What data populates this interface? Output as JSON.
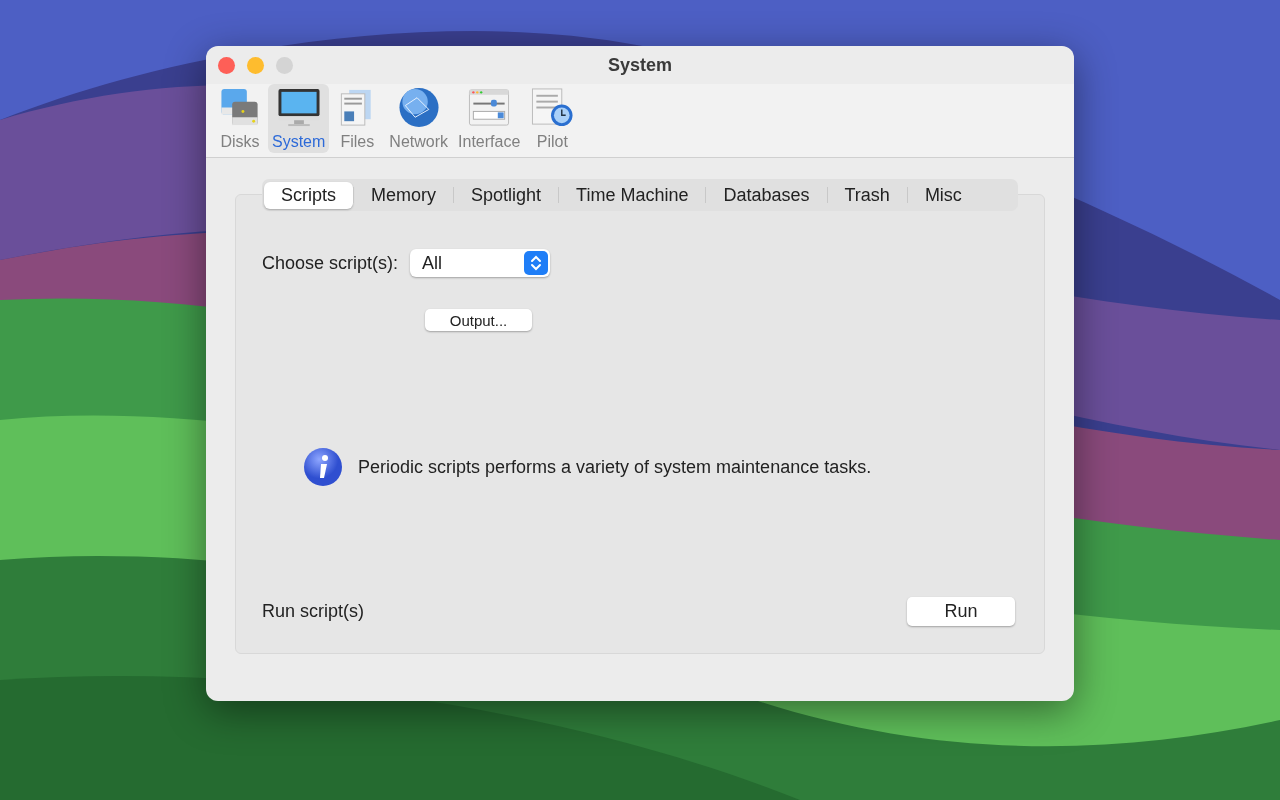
{
  "window": {
    "title": "System",
    "controls": [
      {
        "kind": "close",
        "disabled": false
      },
      {
        "kind": "minimize",
        "disabled": false
      },
      {
        "kind": "zoom",
        "disabled": true
      }
    ]
  },
  "toolbar": [
    {
      "kind": "disks",
      "label": "Disks",
      "selected": false
    },
    {
      "kind": "system",
      "label": "System",
      "selected": true
    },
    {
      "kind": "files",
      "label": "Files",
      "selected": false
    },
    {
      "kind": "network",
      "label": "Network",
      "selected": false
    },
    {
      "kind": "interface",
      "label": "Interface",
      "selected": false
    },
    {
      "kind": "pilot",
      "label": "Pilot",
      "selected": false
    }
  ],
  "tabs": [
    {
      "label": "Scripts",
      "selected": true
    },
    {
      "label": "Memory",
      "selected": false
    },
    {
      "label": "Spotlight",
      "selected": false
    },
    {
      "label": "Time Machine",
      "selected": false
    },
    {
      "label": "Databases",
      "selected": false
    },
    {
      "label": "Trash",
      "selected": false
    },
    {
      "label": "Misc",
      "selected": false
    }
  ],
  "choose": {
    "label": "Choose script(s):",
    "value": "All"
  },
  "output_button": "Output...",
  "info": "Periodic scripts performs a variety of system maintenance tasks.",
  "run": {
    "label": "Run script(s)",
    "button": "Run"
  }
}
